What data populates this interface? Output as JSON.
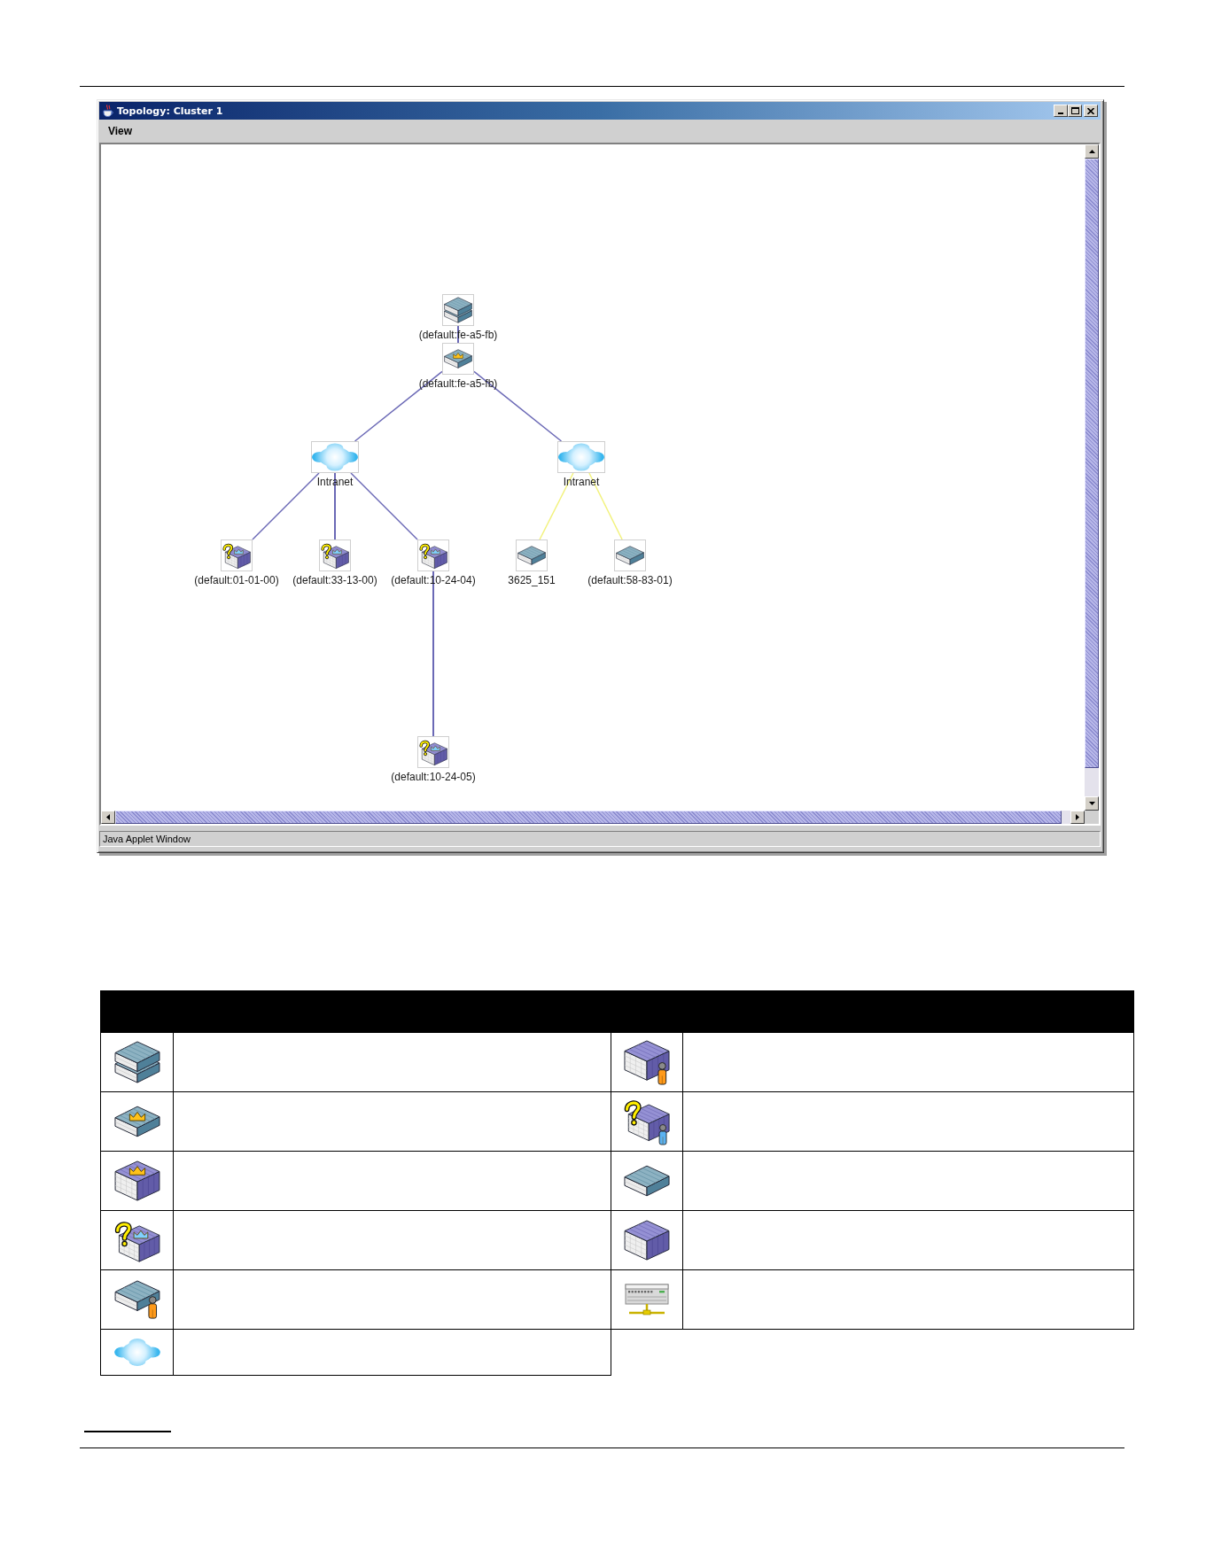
{
  "window": {
    "title": "Topology: Cluster 1",
    "menu": [
      "View"
    ],
    "status_bar": "Java Applet Window"
  },
  "topology": {
    "nodes": [
      {
        "kind": "stacked",
        "label": "(default:fe-a5-fb)",
        "children": [
          {
            "kind": "crowned",
            "label": "(default:fe-a5-fb)",
            "uplink": {
              "color": "#6b69b6"
            },
            "children": [
              {
                "kind": "cloud",
                "label": "Intranet",
                "uplink": {
                  "color": "#6b69b6"
                },
                "children": [
                  {
                    "kind": "question",
                    "label": "(default:01-01-00)",
                    "uplink": {
                      "color": "#6b69b6"
                    }
                  },
                  {
                    "kind": "question",
                    "label": "(default:33-13-00)",
                    "uplink": {
                      "color": "#6b69b6"
                    }
                  },
                  {
                    "kind": "question",
                    "label": "(default:10-24-04)",
                    "uplink": {
                      "color": "#6b69b6"
                    },
                    "children": [
                      {
                        "kind": "question",
                        "label": "(default:10-24-05)",
                        "uplink": {
                          "color": "#6b69b6"
                        }
                      }
                    ]
                  }
                ]
              },
              {
                "kind": "cloud",
                "label": "Intranet",
                "uplink": {
                  "color": "#6b69b6"
                },
                "children": [
                  {
                    "kind": "flat",
                    "label": "3625_151",
                    "uplink": {
                      "color": "#f2f27c"
                    }
                  },
                  {
                    "kind": "flat",
                    "label": "(default:58-83-01)",
                    "uplink": {
                      "color": "#f2f27c"
                    }
                  }
                ]
              }
            ]
          }
        ]
      }
    ]
  },
  "legend": {
    "columns": [
      {
        "rows": [
          {
            "kind": "stacked"
          },
          {
            "kind": "crowned"
          },
          {
            "kind": "crownedbox"
          },
          {
            "kind": "question"
          },
          {
            "kind": "person"
          },
          {
            "kind": "cloud"
          }
        ]
      },
      {
        "rows": [
          {
            "kind": "personbox"
          },
          {
            "kind": "questionperson"
          },
          {
            "kind": "flat"
          },
          {
            "kind": "box"
          },
          {
            "kind": "device"
          }
        ]
      }
    ]
  }
}
